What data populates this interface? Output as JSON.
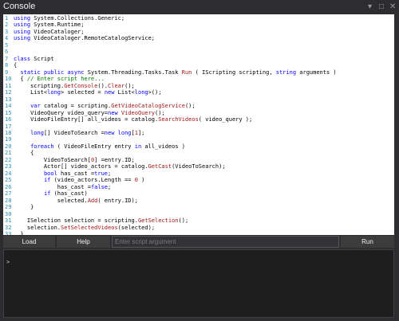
{
  "window": {
    "title": "Console",
    "controls": {
      "pin": "▾",
      "maximize": "□",
      "close": "✕"
    }
  },
  "editor": {
    "lines": [
      [
        {
          "t": "kw",
          "v": "using"
        },
        {
          "t": "tx",
          "v": " System.Collections.Generic;"
        }
      ],
      [
        {
          "t": "kw",
          "v": "using"
        },
        {
          "t": "tx",
          "v": " System.Runtime;"
        }
      ],
      [
        {
          "t": "kw",
          "v": "using"
        },
        {
          "t": "tx",
          "v": " VideoCataloger;"
        }
      ],
      [
        {
          "t": "kw",
          "v": "using"
        },
        {
          "t": "tx",
          "v": " VideoCataloger.RemoteCatalogService;"
        }
      ],
      [],
      [],
      [
        {
          "t": "kw",
          "v": "class"
        },
        {
          "t": "tx",
          "v": " Script"
        }
      ],
      [
        {
          "t": "tx",
          "v": "{"
        }
      ],
      [
        {
          "t": "tx",
          "v": "  "
        },
        {
          "t": "kw",
          "v": "static public async"
        },
        {
          "t": "tx",
          "v": " System.Threading.Tasks.Task "
        },
        {
          "t": "cl",
          "v": "Run"
        },
        {
          "t": "tx",
          "v": " ( IScripting scripting, "
        },
        {
          "t": "kw",
          "v": "string"
        },
        {
          "t": "tx",
          "v": " arguments )"
        }
      ],
      [
        {
          "t": "tx",
          "v": "  { "
        },
        {
          "t": "cm",
          "v": "// Enter script here..."
        }
      ],
      [
        {
          "t": "tx",
          "v": "     scripting."
        },
        {
          "t": "cl",
          "v": "GetConsole"
        },
        {
          "t": "tx",
          "v": "()."
        },
        {
          "t": "cl",
          "v": "Clear"
        },
        {
          "t": "tx",
          "v": "();"
        }
      ],
      [
        {
          "t": "tx",
          "v": "     List<"
        },
        {
          "t": "kw",
          "v": "long"
        },
        {
          "t": "tx",
          "v": "> selected = "
        },
        {
          "t": "kw",
          "v": "new"
        },
        {
          "t": "tx",
          "v": " List<"
        },
        {
          "t": "kw",
          "v": "long"
        },
        {
          "t": "tx",
          "v": ">();"
        }
      ],
      [],
      [
        {
          "t": "tx",
          "v": "     "
        },
        {
          "t": "kw",
          "v": "var"
        },
        {
          "t": "tx",
          "v": " catalog = scripting."
        },
        {
          "t": "cl",
          "v": "GetVideoCatalogService"
        },
        {
          "t": "tx",
          "v": "();"
        }
      ],
      [
        {
          "t": "tx",
          "v": "     VideoQuery video_query="
        },
        {
          "t": "kw",
          "v": "new"
        },
        {
          "t": "tx",
          "v": " "
        },
        {
          "t": "cl",
          "v": "VideoQuery"
        },
        {
          "t": "tx",
          "v": "();"
        }
      ],
      [
        {
          "t": "tx",
          "v": "     VideoFileEntry[] all_videos = catalog."
        },
        {
          "t": "cl",
          "v": "SearchVideos"
        },
        {
          "t": "tx",
          "v": "( video_query );"
        }
      ],
      [],
      [
        {
          "t": "tx",
          "v": "     "
        },
        {
          "t": "kw",
          "v": "long"
        },
        {
          "t": "tx",
          "v": "[] VideoToSearch ="
        },
        {
          "t": "kw",
          "v": "new long"
        },
        {
          "t": "tx",
          "v": "["
        },
        {
          "t": "st",
          "v": "1"
        },
        {
          "t": "tx",
          "v": "];"
        }
      ],
      [],
      [
        {
          "t": "tx",
          "v": "     "
        },
        {
          "t": "kw",
          "v": "foreach"
        },
        {
          "t": "tx",
          "v": " ( VideoFileEntry entry "
        },
        {
          "t": "kw",
          "v": "in"
        },
        {
          "t": "tx",
          "v": " all_videos )"
        }
      ],
      [
        {
          "t": "tx",
          "v": "     {"
        }
      ],
      [
        {
          "t": "tx",
          "v": "         VideoToSearch["
        },
        {
          "t": "st",
          "v": "0"
        },
        {
          "t": "tx",
          "v": "] =entry.ID;"
        }
      ],
      [
        {
          "t": "tx",
          "v": "         Actor[] video_actors = catalog."
        },
        {
          "t": "cl",
          "v": "GetCast"
        },
        {
          "t": "tx",
          "v": "(VideoToSearch);"
        }
      ],
      [
        {
          "t": "tx",
          "v": "         "
        },
        {
          "t": "kw",
          "v": "bool"
        },
        {
          "t": "tx",
          "v": " has_cast ="
        },
        {
          "t": "kw",
          "v": "true"
        },
        {
          "t": "tx",
          "v": ";"
        }
      ],
      [
        {
          "t": "tx",
          "v": "         "
        },
        {
          "t": "kw",
          "v": "if"
        },
        {
          "t": "tx",
          "v": " (video_actors.Length == "
        },
        {
          "t": "st",
          "v": "0"
        },
        {
          "t": "tx",
          "v": " )"
        }
      ],
      [
        {
          "t": "tx",
          "v": "             has_cast ="
        },
        {
          "t": "kw",
          "v": "false"
        },
        {
          "t": "tx",
          "v": ";"
        }
      ],
      [
        {
          "t": "tx",
          "v": "         "
        },
        {
          "t": "kw",
          "v": "if"
        },
        {
          "t": "tx",
          "v": " (has_cast)"
        }
      ],
      [
        {
          "t": "tx",
          "v": "             selected."
        },
        {
          "t": "cl",
          "v": "Add"
        },
        {
          "t": "tx",
          "v": "( entry.ID);"
        }
      ],
      [
        {
          "t": "tx",
          "v": "     }"
        }
      ],
      [],
      [
        {
          "t": "tx",
          "v": "    ISelection selection = scripting."
        },
        {
          "t": "cl",
          "v": "GetSelection"
        },
        {
          "t": "tx",
          "v": "();"
        }
      ],
      [
        {
          "t": "tx",
          "v": "    selection."
        },
        {
          "t": "cl",
          "v": "SetSelectedVideos"
        },
        {
          "t": "tx",
          "v": "(selected);"
        }
      ],
      [
        {
          "t": "tx",
          "v": "  }"
        }
      ],
      [
        {
          "t": "tx",
          "v": "}"
        }
      ]
    ]
  },
  "toolbar": {
    "load_label": "Load",
    "help_label": "Help",
    "argument_placeholder": "Enter script argument",
    "argument_value": "",
    "run_label": "Run"
  },
  "output": {
    "prompt": ">"
  }
}
